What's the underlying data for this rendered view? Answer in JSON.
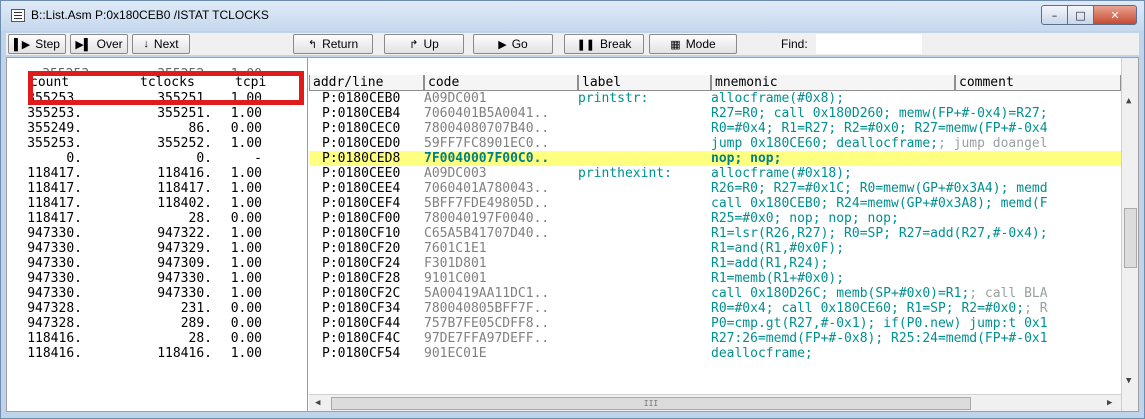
{
  "window": {
    "title": "B::List.Asm P:0x180CEB0 /ISTAT TCLOCKS",
    "min_label": "–",
    "max_label": "□",
    "close_label": "✕"
  },
  "toolbar": {
    "buttons": [
      {
        "icon": "step-icon",
        "glyph": "▌▶",
        "label": "Step"
      },
      {
        "icon": "over-icon",
        "glyph": "▶▌",
        "label": "Over"
      },
      {
        "icon": "next-icon",
        "glyph": "↓",
        "label": "Next"
      },
      {
        "icon": "return-icon",
        "glyph": "↰",
        "label": "Return"
      },
      {
        "icon": "up-icon",
        "glyph": "↱",
        "label": "Up"
      },
      {
        "icon": "go-icon",
        "glyph": "▶",
        "label": "Go"
      },
      {
        "icon": "break-icon",
        "glyph": "❚❚",
        "label": "Break"
      },
      {
        "icon": "mode-icon",
        "glyph": "▦",
        "label": "Mode"
      }
    ],
    "find_label": "Find:",
    "find_value": ""
  },
  "columns": {
    "left": [
      "count",
      "tclocks",
      "tcpi"
    ],
    "right": [
      "addr/line",
      "code",
      "label",
      "mnemonic",
      "comment"
    ]
  },
  "partial_top_row": {
    "count": "355253.",
    "tclocks": "355252.",
    "tcpi": "1.00"
  },
  "rows": [
    {
      "count": "355253.",
      "tclocks": "355251.",
      "tcpi": "1.00",
      "addr": "P:0180CEB0",
      "code": "A09DC001",
      "label": "printstr:",
      "mnemonic": "allocframe(#0x8);",
      "comment": ""
    },
    {
      "count": "355253.",
      "tclocks": "355251.",
      "tcpi": "1.00",
      "addr": "P:0180CEB4",
      "code": "7060401B5A0041..",
      "label": "",
      "mnemonic": "R27=R0; call 0x180D260; memw(FP+#-0x4)=R27;",
      "comment": ""
    },
    {
      "count": "355249.",
      "tclocks": "86.",
      "tcpi": "0.00",
      "addr": "P:0180CEC0",
      "code": "78004080707B40..",
      "label": "",
      "mnemonic": "R0=#0x4; R1=R27; R2=#0x0; R27=memw(FP+#-0x4",
      "comment": ""
    },
    {
      "count": "355253.",
      "tclocks": "355252.",
      "tcpi": "1.00",
      "addr": "P:0180CED0",
      "code": "59FF7FC8901EC0..",
      "label": "",
      "mnemonic": "jump 0x180CE60; deallocframe;",
      "comment": "; jump doangel"
    },
    {
      "count": "0.",
      "tclocks": "0.",
      "tcpi": "-",
      "addr": "P:0180CED8",
      "code": "7F0040007F00C0..",
      "label": "",
      "mnemonic": "nop; nop;",
      "comment": "",
      "highlight": true
    },
    {
      "count": "118417.",
      "tclocks": "118416.",
      "tcpi": "1.00",
      "addr": "P:0180CEE0",
      "code": "A09DC003",
      "label": "printhexint:",
      "mnemonic": "allocframe(#0x18);",
      "comment": ""
    },
    {
      "count": "118417.",
      "tclocks": "118417.",
      "tcpi": "1.00",
      "addr": "P:0180CEE4",
      "code": "7060401A780043..",
      "label": "",
      "mnemonic": "R26=R0; R27=#0x1C; R0=memw(GP+#0x3A4); memd",
      "comment": ""
    },
    {
      "count": "118417.",
      "tclocks": "118402.",
      "tcpi": "1.00",
      "addr": "P:0180CEF4",
      "code": "5BFF7FDE49805D..",
      "label": "",
      "mnemonic": "call 0x180CEB0; R24=memw(GP+#0x3A8); memd(F",
      "comment": ""
    },
    {
      "count": "118417.",
      "tclocks": "28.",
      "tcpi": "0.00",
      "addr": "P:0180CF00",
      "code": "780040197F0040..",
      "label": "",
      "mnemonic": "R25=#0x0; nop; nop; nop;",
      "comment": ""
    },
    {
      "count": "947330.",
      "tclocks": "947322.",
      "tcpi": "1.00",
      "addr": "P:0180CF10",
      "code": "C65A5B41707D40..",
      "label": "",
      "mnemonic": "R1=lsr(R26,R27); R0=SP; R27=add(R27,#-0x4);",
      "comment": ""
    },
    {
      "count": "947330.",
      "tclocks": "947329.",
      "tcpi": "1.00",
      "addr": "P:0180CF20",
      "code": "7601C1E1",
      "label": "",
      "mnemonic": "R1=and(R1,#0x0F);",
      "comment": ""
    },
    {
      "count": "947330.",
      "tclocks": "947309.",
      "tcpi": "1.00",
      "addr": "P:0180CF24",
      "code": "F301D801",
      "label": "",
      "mnemonic": "R1=add(R1,R24);",
      "comment": ""
    },
    {
      "count": "947330.",
      "tclocks": "947330.",
      "tcpi": "1.00",
      "addr": "P:0180CF28",
      "code": "9101C001",
      "label": "",
      "mnemonic": "R1=memb(R1+#0x0);",
      "comment": ""
    },
    {
      "count": "947330.",
      "tclocks": "947330.",
      "tcpi": "1.00",
      "addr": "P:0180CF2C",
      "code": "5A00419AA11DC1..",
      "label": "",
      "mnemonic": "call 0x180D26C; memb(SP+#0x0)=R1;",
      "comment": "; call BLA"
    },
    {
      "count": "947328.",
      "tclocks": "231.",
      "tcpi": "0.00",
      "addr": "P:0180CF34",
      "code": "780040805BFF7F..",
      "label": "",
      "mnemonic": "R0=#0x4; call 0x180CE60; R1=SP; R2=#0x0;",
      "comment": "; R"
    },
    {
      "count": "947328.",
      "tclocks": "289.",
      "tcpi": "0.00",
      "addr": "P:0180CF44",
      "code": "757B7FE05CDFF8..",
      "label": "",
      "mnemonic": "P0=cmp.gt(R27,#-0x1); if(P0.new) jump:t 0x1",
      "comment": ""
    },
    {
      "count": "118416.",
      "tclocks": "28.",
      "tcpi": "0.00",
      "addr": "P:0180CF4C",
      "code": "97DE7FFA97DEFF..",
      "label": "",
      "mnemonic": "R27:26=memd(FP+#-0x8); R25:24=memd(FP+#-0x1",
      "comment": ""
    },
    {
      "count": "118416.",
      "tclocks": "118416.",
      "tcpi": "1.00",
      "addr": "P:0180CF54",
      "code": "901EC01E",
      "label": "",
      "mnemonic": "deallocframe;",
      "comment": ""
    }
  ],
  "hscroll_label": "III"
}
